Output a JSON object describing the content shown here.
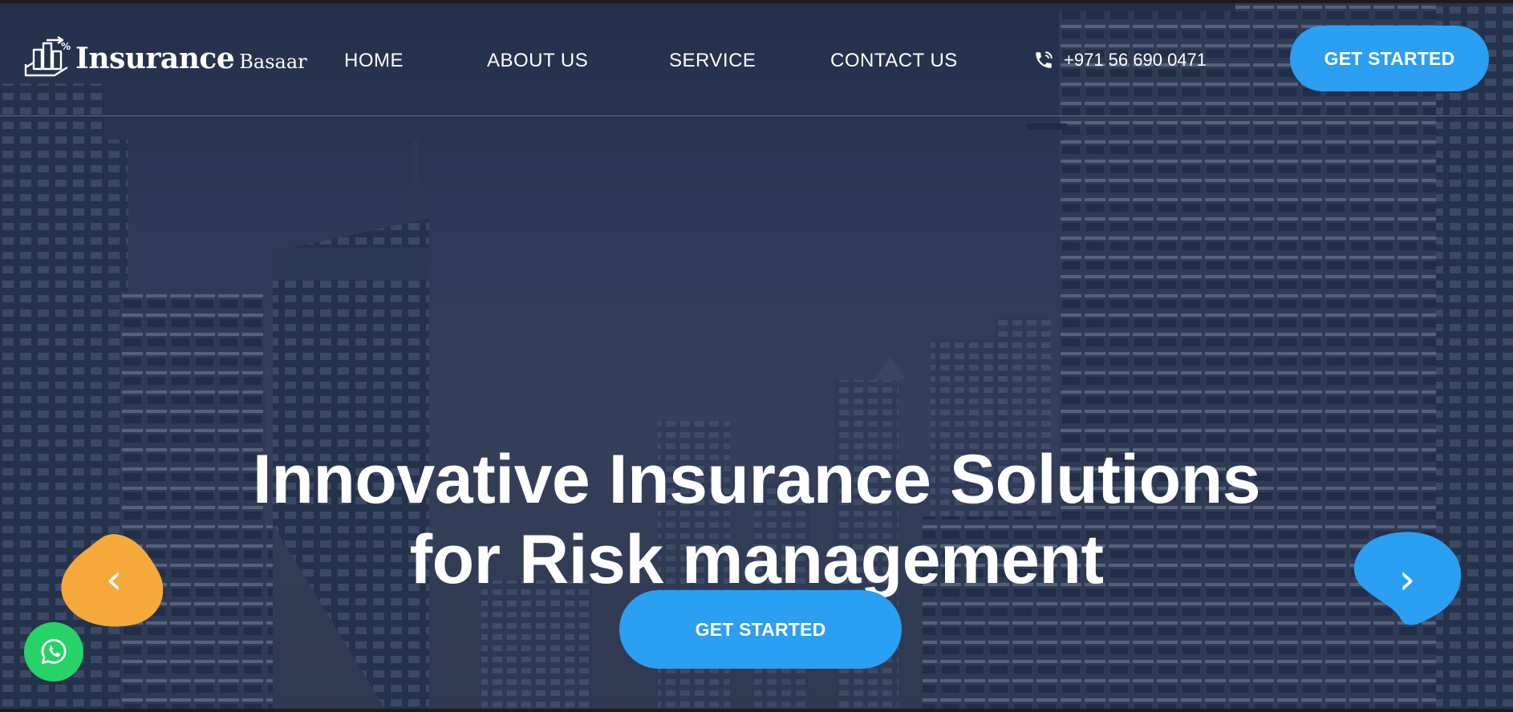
{
  "header": {
    "logo": {
      "name": "Insurance",
      "suffix": "Basaar"
    },
    "nav": [
      {
        "label": "HOME"
      },
      {
        "label": "ABOUT US"
      },
      {
        "label": "SERVICE"
      },
      {
        "label": "CONTACT US"
      }
    ],
    "phone": {
      "icon": "phone-icon",
      "number": "+971 56 690 0471"
    },
    "cta_label": "GET STARTED"
  },
  "hero": {
    "title_line1": "Innovative Insurance Solutions",
    "title_line2": "for Risk management",
    "cta_label": "GET STARTED",
    "prev_arrow": "‹",
    "next_arrow": "›"
  },
  "colors": {
    "accent_blue": "#2b9ff2",
    "accent_orange": "#f6a93b",
    "whatsapp_green": "#25d366"
  },
  "icons": {
    "whatsapp": "whatsapp-icon",
    "phone": "phone-icon",
    "logo": "building-chart-logo-icon"
  }
}
